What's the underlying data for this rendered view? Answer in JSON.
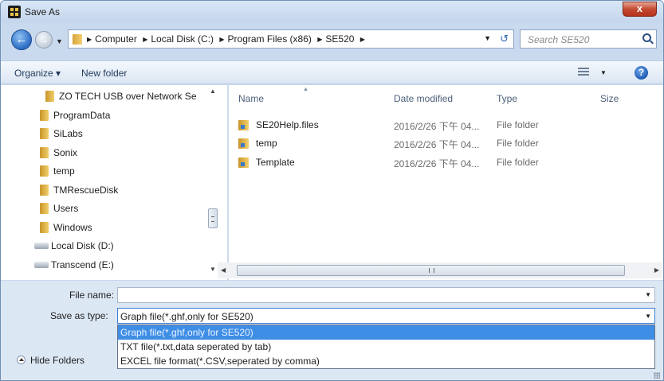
{
  "window": {
    "title": "Save As",
    "close_label": "x"
  },
  "address": {
    "crumbs": [
      "Computer",
      "Local Disk (C:)",
      "Program Files (x86)",
      "SE520"
    ],
    "search_placeholder": "Search SE520"
  },
  "toolbar": {
    "organize_label": "Organize ▾",
    "new_folder_label": "New folder"
  },
  "nav": {
    "items": [
      {
        "label": "ZO TECH USB over Network Se",
        "icon": "folder-icon"
      },
      {
        "label": "ProgramData",
        "icon": "folder-icon"
      },
      {
        "label": "SiLabs",
        "icon": "folder-icon"
      },
      {
        "label": "Sonix",
        "icon": "folder-icon"
      },
      {
        "label": "temp",
        "icon": "folder-icon"
      },
      {
        "label": "TMRescueDisk",
        "icon": "folder-icon"
      },
      {
        "label": "Users",
        "icon": "folder-icon"
      },
      {
        "label": "Windows",
        "icon": "folder-icon"
      },
      {
        "label": "Local Disk (D:)",
        "icon": "disk-icon"
      },
      {
        "label": "Transcend (E:)",
        "icon": "disk-icon"
      }
    ]
  },
  "files": {
    "columns": [
      "Name",
      "Date modified",
      "Type",
      "Size"
    ],
    "rows": [
      {
        "name": "SE20Help.files",
        "date": "2016/2/26 下午 04...",
        "type": "File folder"
      },
      {
        "name": "temp",
        "date": "2016/2/26 下午 04...",
        "type": "File folder"
      },
      {
        "name": "Template",
        "date": "2016/2/26 下午 04...",
        "type": "File folder"
      }
    ]
  },
  "form": {
    "file_name_label": "File name:",
    "file_name_value": "",
    "save_type_label": "Save as type:",
    "save_type_value": "Graph file(*.ghf,only for SE520)",
    "type_options": [
      "Graph file(*.ghf,only for SE520)",
      "TXT file(*.txt,data seperated by tab)",
      "EXCEL file format(*.CSV,seperated by comma)"
    ],
    "hide_folders_label": "Hide Folders"
  }
}
